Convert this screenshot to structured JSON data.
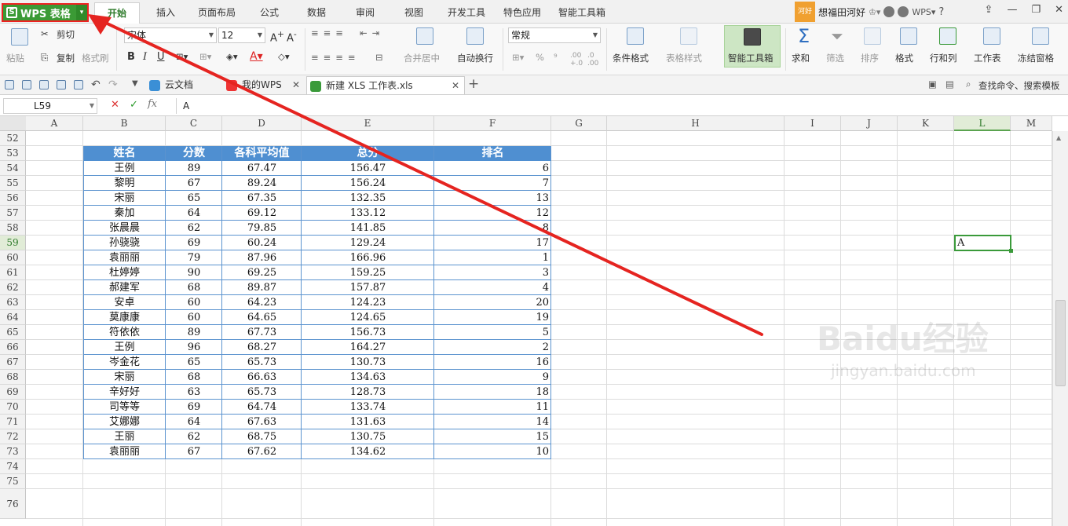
{
  "menubar": {
    "app_button": "WPS 表格",
    "tabs": [
      "开始",
      "插入",
      "页面布局",
      "公式",
      "数据",
      "审阅",
      "视图",
      "开发工具",
      "特色应用",
      "智能工具箱"
    ],
    "user_badge": "河好",
    "user_name": "想福田河好",
    "help": "?"
  },
  "ribbon": {
    "paste": "粘贴",
    "cut": "剪切",
    "copy": "复制",
    "format_painter": "格式刷",
    "font_name": "宋体",
    "font_size": "12",
    "bold": "B",
    "italic": "I",
    "underline": "U",
    "merge_center": "合并居中",
    "wrap_text": "自动换行",
    "number_format": "常规",
    "percent": "%",
    "comma": "⁹",
    "conditional_format": "条件格式",
    "table_style": "表格样式",
    "smart_toolbox": "智能工具箱",
    "sum": "求和",
    "filter": "筛选",
    "sort": "排序",
    "format": "格式",
    "rows_cols": "行和列",
    "worksheet": "工作表",
    "freeze": "冻结窗格"
  },
  "doctabs": {
    "cloud": "云文档",
    "mywps": "我的WPS",
    "file": "新建 XLS 工作表.xls",
    "search": "查找命令、搜索模板"
  },
  "formula": {
    "cell_ref": "L59",
    "value": "A",
    "fx": "fx"
  },
  "columns": [
    "A",
    "B",
    "C",
    "D",
    "E",
    "F",
    "G",
    "H",
    "I",
    "J",
    "K",
    "L",
    "M"
  ],
  "rows": [
    "52",
    "53",
    "54",
    "55",
    "56",
    "57",
    "58",
    "59",
    "60",
    "61",
    "62",
    "63",
    "64",
    "65",
    "66",
    "67",
    "68",
    "69",
    "70",
    "71",
    "72",
    "73",
    "74",
    "75",
    "76"
  ],
  "table": {
    "headers": [
      "姓名",
      "分数",
      "各科平均值",
      "总分",
      "排名"
    ],
    "rows": [
      [
        "王例",
        "89",
        "67.47",
        "156.47",
        "6"
      ],
      [
        "黎明",
        "67",
        "89.24",
        "156.24",
        "7"
      ],
      [
        "宋丽",
        "65",
        "67.35",
        "132.35",
        "13"
      ],
      [
        "秦加",
        "64",
        "69.12",
        "133.12",
        "12"
      ],
      [
        "张晨晨",
        "62",
        "79.85",
        "141.85",
        "8"
      ],
      [
        "孙骁骁",
        "69",
        "60.24",
        "129.24",
        "17"
      ],
      [
        "袁丽丽",
        "79",
        "87.96",
        "166.96",
        "1"
      ],
      [
        "杜婷婷",
        "90",
        "69.25",
        "159.25",
        "3"
      ],
      [
        "郝建军",
        "68",
        "89.87",
        "157.87",
        "4"
      ],
      [
        "安卓",
        "60",
        "64.23",
        "124.23",
        "20"
      ],
      [
        "莫康康",
        "60",
        "64.65",
        "124.65",
        "19"
      ],
      [
        "符依依",
        "89",
        "67.73",
        "156.73",
        "5"
      ],
      [
        "王例",
        "96",
        "68.27",
        "164.27",
        "2"
      ],
      [
        "岑金花",
        "65",
        "65.73",
        "130.73",
        "16"
      ],
      [
        "宋丽",
        "68",
        "66.63",
        "134.63",
        "9"
      ],
      [
        "辛好好",
        "63",
        "65.73",
        "128.73",
        "18"
      ],
      [
        "司等等",
        "69",
        "64.74",
        "133.74",
        "11"
      ],
      [
        "艾娜娜",
        "64",
        "67.63",
        "131.63",
        "14"
      ],
      [
        "王丽",
        "62",
        "68.75",
        "130.75",
        "15"
      ],
      [
        "袁丽丽",
        "67",
        "67.62",
        "134.62",
        "10"
      ]
    ]
  },
  "active_cell_value": "A",
  "watermark": {
    "main": "Baidu经验",
    "sub": "jingyan.baidu.com"
  },
  "colors": {
    "accent_green": "#3b9a35",
    "table_header": "#4f8fd1",
    "annotation_red": "#e52420"
  }
}
